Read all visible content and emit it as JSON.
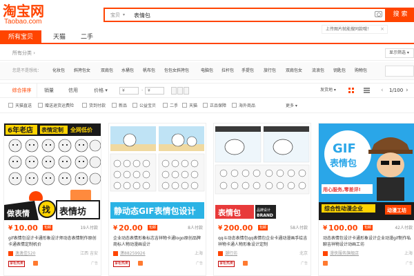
{
  "header": {
    "logo_main": "淘宝网",
    "logo_sub": "Taobao.com",
    "search_scope": "宝贝",
    "search_query": "表情包",
    "search_button": "搜索",
    "upload_tip": "上传图片就能搜同款哦！",
    "upload_tip_close": "×"
  },
  "tabs": [
    {
      "label": "所有宝贝"
    },
    {
      "label": "天猫"
    },
    {
      "label": "二手"
    }
  ],
  "category": {
    "all_label": "所有分类 ›",
    "display_select": "显示筛选 ▾"
  },
  "filters": {
    "label": "您是不是想找：",
    "tags": [
      "化妆包",
      "斜挎包女",
      "双肩包",
      "水桶包",
      "帆布包",
      "包包女斜挎包",
      "电脑包",
      "拉杆包",
      "手提包",
      "旅行包",
      "双肩包女",
      "流浪包",
      "钥匙包",
      "购物包"
    ]
  },
  "sort": {
    "items": [
      "综合排序",
      "销量",
      "信用",
      "价格 ▾"
    ],
    "price_from": "¥",
    "price_to": "¥",
    "ship_from": "发货地 ▾",
    "pager_prev": "‹",
    "pager_text": "1/100",
    "pager_next": "›"
  },
  "checks": {
    "items": [
      "天猫直送",
      "赠送退货运费险",
      "货到付款",
      "新品",
      "公益宝贝",
      "二手",
      "天猫",
      "正品保障",
      "海外商品"
    ],
    "more": "更多 ▾"
  },
  "products": [
    {
      "price_currency": "¥",
      "price": "10.00",
      "ship_badge": "包邮",
      "paid_count": "19人付款",
      "title": "gif表情包设计卡通形象设计师动态表情制作原创卡通表情定制机价",
      "shop": "逸逸佳520",
      "location": "江西 吉安",
      "hot_badge": "掌柜热卖",
      "ad": "广告",
      "img_top": "6年老店",
      "img_top2": "表情定制",
      "img_top3": "全网低价",
      "img_left": "做表情",
      "img_mid": "找",
      "img_right": "表情坊"
    },
    {
      "price_currency": "¥",
      "price": "20.00",
      "ship_badge": "包邮",
      "paid_count": "8人付款",
      "title": "企业动态表情形象标志吉祥物卡通logo原创品牌商标人物动漫画设计",
      "shop": "潇88259926",
      "location": "上海",
      "hot_badge": "掌柜热卖",
      "ad": "广告",
      "img_banner": "静动态GIF表情包设计"
    },
    {
      "price_currency": "¥",
      "price": "200.00",
      "ship_badge": "包邮",
      "paid_count": "58人付款",
      "title": "qq斗动态表情包qq表情包企业卡通动漫画手绘吉祥物卡通人物形象设计定制",
      "shop": "潮行坊",
      "location": "北京",
      "hot_badge": "掌柜热卖",
      "ad": "广告",
      "img_banner": "表情包",
      "img_brand": "BRAND",
      "img_brand_cn": "品牌设计"
    },
    {
      "price_currency": "¥",
      "price": "100.00",
      "ship_badge": "包邮",
      "paid_count": "42人付款",
      "title": "动态表情包设计卡通形象设计企业动漫gif制作私聊吉祥物设计动画工坊",
      "shop": "漫侠服务旗舰店",
      "location": "上海",
      "hot_badge": "",
      "ad": "广告",
      "img_title1": "GIF",
      "img_title2": "表情包",
      "img_left": "用心服务,零差评!",
      "img_bottom": "综合性动漫企业",
      "img_stamp": "动漫工坊"
    }
  ],
  "colors": {
    "brand": "#ff4400",
    "price": "#ff4400",
    "hot": "#c40000"
  }
}
